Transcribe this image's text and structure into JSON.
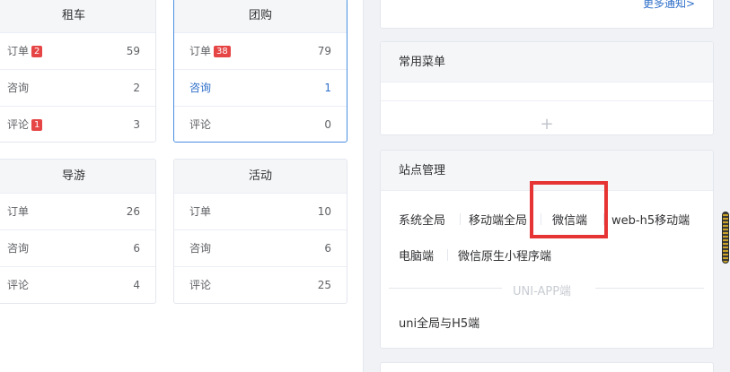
{
  "cards": [
    {
      "title": "租车",
      "rows": [
        {
          "label": "订单",
          "badge": "2",
          "value": "59"
        },
        {
          "label": "咨询",
          "value": "2"
        },
        {
          "label": "评论",
          "badge": "1",
          "value": "3"
        }
      ]
    },
    {
      "title": "团购",
      "rows": [
        {
          "label": "订单",
          "badge": "38",
          "value": "79"
        },
        {
          "label": "咨询",
          "value": "1"
        },
        {
          "label": "评论",
          "value": "0"
        }
      ]
    },
    {
      "title": "导游",
      "rows": [
        {
          "label": "订单",
          "value": "26"
        },
        {
          "label": "咨询",
          "value": "6"
        },
        {
          "label": "评论",
          "value": "4"
        }
      ]
    },
    {
      "title": "活动",
      "rows": [
        {
          "label": "订单",
          "value": "10"
        },
        {
          "label": "咨询",
          "value": "6"
        },
        {
          "label": "评论",
          "value": "25"
        }
      ]
    }
  ],
  "notice": {
    "more_link": "更多通知>"
  },
  "common_menu": {
    "title": "常用菜单",
    "add_icon": "plus-icon",
    "add_symbol": "+"
  },
  "site": {
    "title": "站点管理",
    "items": [
      "系统全局",
      "移动端全局",
      "微信端",
      "web-h5移动端",
      "电脑端",
      "微信原生小程序端"
    ],
    "divider": "UNI-APP端",
    "uni_item": "uni全局与H5端"
  },
  "colors": {
    "accent": "#2f6fc9",
    "badge": "#e64545",
    "highlight": "#e63333"
  }
}
